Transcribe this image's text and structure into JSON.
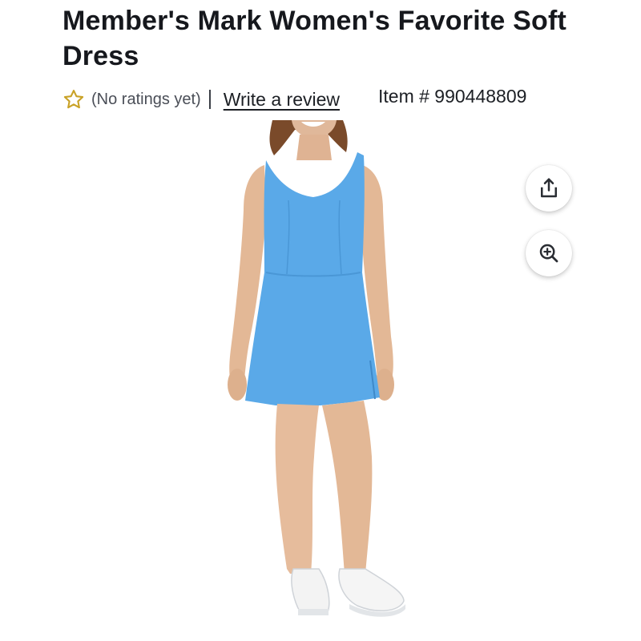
{
  "product": {
    "title": "Member's Mark Women's Favorite Soft Dress",
    "ratings_text": "(No ratings yet)",
    "write_review_label": "Write a review",
    "item_number_text": "Item # 990448809"
  },
  "image": {
    "subject": "Model wearing sky-blue sleeveless V-neck dress with white sneakers",
    "dress_color": "#5aa9e8"
  },
  "actions": {
    "share_icon": "share-icon",
    "zoom_icon": "zoom-in-icon"
  },
  "colors": {
    "star_outline": "#c9a227",
    "title_text": "#16181d",
    "muted_text": "#4a4e57"
  }
}
